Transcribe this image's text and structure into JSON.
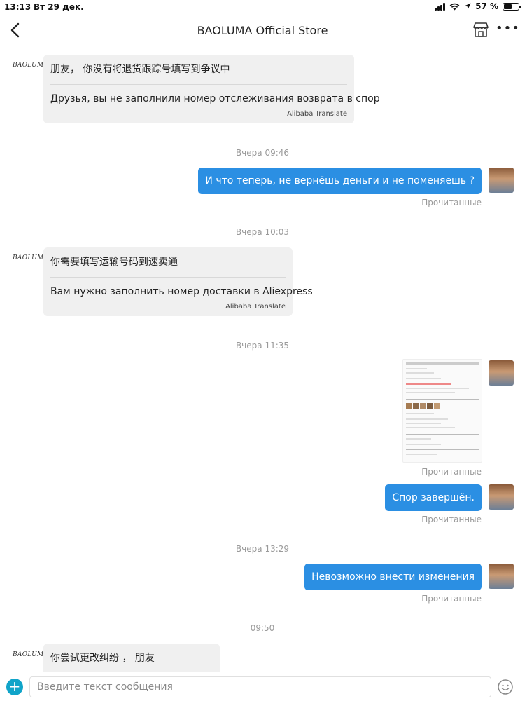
{
  "status_bar": {
    "time": "13:13",
    "date": "Вт 29 дек.",
    "battery": "57 %",
    "battery_level": 0.57
  },
  "header": {
    "title": "BAOLUMA Official Store"
  },
  "seller": {
    "logo_text": "BAOLUMA"
  },
  "messages": [
    {
      "original": "朋友， 你没有将退货跟踪号填写到争议中",
      "translation": "Друзья, вы не заполнили номер отслеживания возврата в спор",
      "credit": "Alibaba Translate"
    },
    {
      "timestamp": "Вчера 09:46",
      "text": "И что теперь, не вернёшь деньги и не поменяешь ?",
      "status": "Прочитанные"
    },
    {
      "timestamp": "Вчера 10:03",
      "original": "你需要填写运输号码到速卖通",
      "translation": "Вам нужно заполнить номер доставки в Aliexpress",
      "credit": "Alibaba Translate"
    },
    {
      "timestamp": "Вчера 11:35",
      "status": "Прочитанные"
    },
    {
      "text": "Спор завершён.",
      "status": "Прочитанные"
    },
    {
      "timestamp": "Вчера 13:29",
      "text": "Невозможно внести изменения",
      "status": "Прочитанные"
    },
    {
      "timestamp": "09:50",
      "original": "你尝试更改纠纷 ， 朋友"
    }
  ],
  "input": {
    "placeholder": "Введите текст сообщения"
  },
  "colors": {
    "outgoing_bubble": "#2b8fe3",
    "incoming_bubble": "#f0f0f0",
    "plus_button": "#10a4c9"
  },
  "icons": {
    "back": "chevron-left-icon",
    "store": "store-icon",
    "more": "more-dots-icon",
    "add": "plus-icon",
    "emoji": "emoji-icon"
  }
}
